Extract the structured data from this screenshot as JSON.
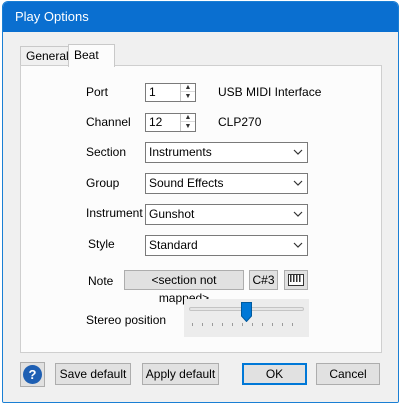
{
  "window": {
    "title": "Play Options"
  },
  "tabs": {
    "general": "General",
    "beat": "Beat",
    "selected": "Beat"
  },
  "port": {
    "label": "Port",
    "value": "1",
    "device": "USB MIDI Interface"
  },
  "channel": {
    "label": "Channel",
    "value": "12",
    "device": "CLP270"
  },
  "section": {
    "label": "Section",
    "value": "Instruments"
  },
  "group": {
    "label": "Group",
    "value": "Sound Effects"
  },
  "instrument": {
    "label": "Instrument",
    "value": "Gunshot"
  },
  "style": {
    "label": "Style",
    "value": "Standard"
  },
  "note": {
    "label": "Note",
    "mapping": "<section not mapped>",
    "pitch": "C#3"
  },
  "stereo": {
    "label": "Stereo position",
    "position": 0.5
  },
  "buttons": {
    "save_default": "Save default",
    "apply_default": "Apply default",
    "ok": "OK",
    "cancel": "Cancel"
  },
  "colors": {
    "titlebar": "#0a6fd0",
    "accent": "#0078d7",
    "help_icon": "#1e5fb3"
  },
  "icons": {
    "help": "question-mark-icon",
    "spin": "spin-arrows-icon",
    "dropdown": "chevron-down-icon",
    "keyboard": "piano-keyboard-icon"
  }
}
